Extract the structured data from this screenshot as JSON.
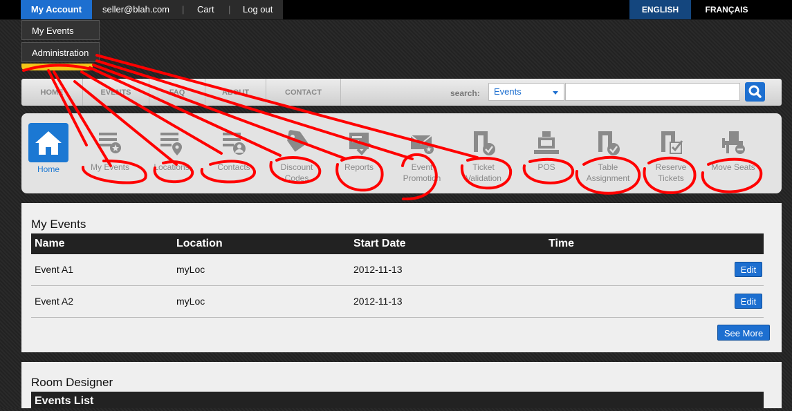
{
  "topbar": {
    "account": "My Account",
    "email": "seller@blah.com",
    "cart": "Cart",
    "logout": "Log out",
    "separator": "|",
    "lang_en": "ENGLISH",
    "lang_fr": "FRANÇAIS"
  },
  "account_menu": {
    "items": [
      "My Events",
      "Administration"
    ]
  },
  "nav": {
    "items": [
      "HOME",
      "EVENTS",
      "FAQ",
      "ABOUT",
      "CONTACT"
    ],
    "search_label": "search:",
    "search_scope": "Events",
    "search_value": ""
  },
  "tools": [
    {
      "label": "Home",
      "icon": "home-icon"
    },
    {
      "label": "My Events",
      "icon": "events-list-icon"
    },
    {
      "label": "Locations",
      "icon": "location-icon"
    },
    {
      "label": "Contacts",
      "icon": "contacts-icon"
    },
    {
      "label": "Discount",
      "label2": "Codes",
      "icon": "tag-icon"
    },
    {
      "label": "Reports",
      "icon": "reports-icon"
    },
    {
      "label": "Event",
      "label2": "Promotion",
      "icon": "envelope-icon"
    },
    {
      "label": "Ticket",
      "label2": "Validation",
      "icon": "ticket-check-icon"
    },
    {
      "label": "POS",
      "icon": "register-icon"
    },
    {
      "label": "Table",
      "label2": "Assignment",
      "icon": "table-check-icon"
    },
    {
      "label": "Reserve",
      "label2": "Tickets",
      "icon": "reserve-tickets-icon"
    },
    {
      "label": "Move Seats",
      "icon": "move-seat-icon"
    }
  ],
  "my_events": {
    "title": "My Events",
    "columns": [
      "Name",
      "Location",
      "Start Date",
      "Time"
    ],
    "rows": [
      {
        "name": "Event A1",
        "location": "myLoc",
        "start": "2012-11-13",
        "time": "",
        "action": "Edit"
      },
      {
        "name": "Event A2",
        "location": "myLoc",
        "start": "2012-11-13",
        "time": "",
        "action": "Edit"
      }
    ],
    "see_more": "See More"
  },
  "room_designer": {
    "title": "Room Designer",
    "list_header": "Events List"
  },
  "colors": {
    "accent": "#1d6fd0",
    "annotation": "#ff0000",
    "logo_yellow": "#f4c518"
  }
}
